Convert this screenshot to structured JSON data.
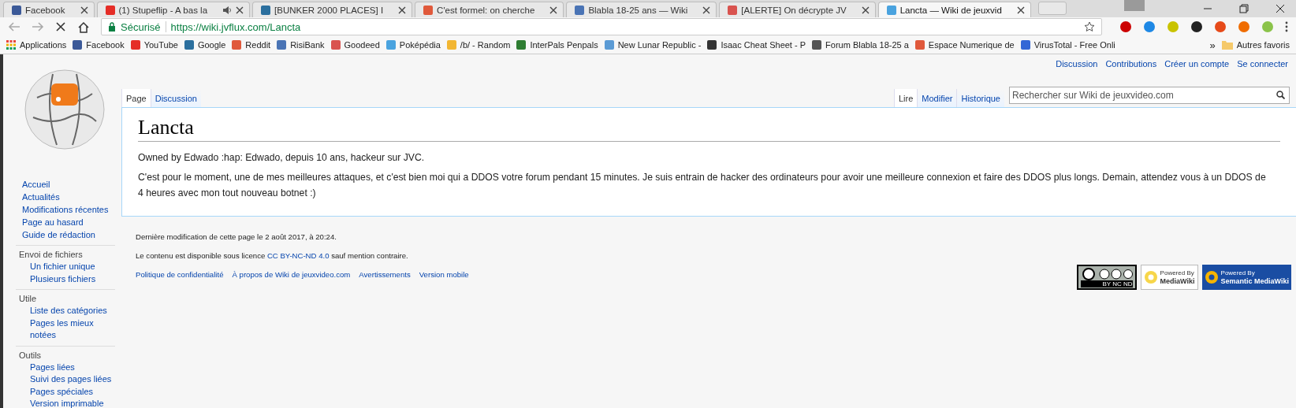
{
  "browser": {
    "tabs": [
      {
        "title": "Facebook",
        "selected": false,
        "audio": false
      },
      {
        "title": "(1) Stupeflip - A bas la",
        "selected": false,
        "audio": true
      },
      {
        "title": "[BUNKER 2000 PLACES] I",
        "selected": false,
        "audio": false
      },
      {
        "title": "C'est formel: on cherche",
        "selected": false,
        "audio": false
      },
      {
        "title": "Blabla 18-25 ans — Wiki",
        "selected": false,
        "audio": false
      },
      {
        "title": "[ALERTE] On décrypte JV",
        "selected": false,
        "audio": false
      },
      {
        "title": "Lancta — Wiki de jeuxvid",
        "selected": true,
        "audio": false
      }
    ],
    "address": {
      "security": "Sécurisé",
      "url": "https://wiki.jvflux.com/Lancta"
    },
    "bookmarks": [
      "Applications",
      "Facebook",
      "YouTube",
      "Google",
      "Reddit",
      "RisiBank",
      "Goodeed",
      "Poképédia",
      "/b/ - Random",
      "InterPals Penpals",
      "New Lunar Republic -",
      "Isaac Cheat Sheet - P",
      "Forum Blabla 18-25 a",
      "Espace Numerique de",
      "VirusTotal - Free Onli"
    ],
    "bookmarks_overflow": "»",
    "other_bookmarks": "Autres favoris"
  },
  "page": {
    "personal": [
      "Discussion",
      "Contributions",
      "Créer un compte",
      "Se connecter"
    ],
    "left_tabs": [
      {
        "label": "Page",
        "selected": true
      },
      {
        "label": "Discussion",
        "selected": false
      }
    ],
    "right_tabs": [
      {
        "label": "Lire",
        "selected": true
      },
      {
        "label": "Modifier",
        "selected": false
      },
      {
        "label": "Historique",
        "selected": false
      }
    ],
    "search": {
      "placeholder": "Rechercher sur Wiki de jeuxvideo.com"
    },
    "title": "Lancta",
    "paragraphs": [
      "Owned by Edwado :hap: Edwado, depuis 10 ans, hackeur sur JVC.",
      "C'est pour le moment, une de mes meilleures attaques, et c'est bien moi qui a DDOS votre forum pendant 15 minutes. Je suis entrain de hacker des ordinateurs pour avoir une meilleure connexion et faire des DDOS plus longs. Demain, attendez vous à un DDOS de 4 heures avec mon tout nouveau botnet :)"
    ],
    "sidebar": [
      {
        "items": [
          "Accueil",
          "Actualités",
          "Modifications récentes",
          "Page au hasard",
          "Guide de rédaction"
        ]
      },
      {
        "heading": "Envoi de fichiers",
        "items": [
          "Un fichier unique",
          "Plusieurs fichiers"
        ]
      },
      {
        "heading": "Utile",
        "items": [
          "Liste des catégories",
          "Pages les mieux notées"
        ]
      },
      {
        "heading": "Outils",
        "items": [
          "Pages liées",
          "Suivi des pages liées",
          "Pages spéciales",
          "Version imprimable"
        ]
      }
    ],
    "footer": {
      "last_modified": "Dernière modification de cette page le 2 août 2017, à 20:24.",
      "license": {
        "before": "Le contenu est disponible sous licence ",
        "link": "CC BY-NC-ND 4.0",
        "after": " sauf mention contraire."
      },
      "links": [
        "Politique de confidentialité",
        "À propos de Wiki de jeuxvideo.com",
        "Avertissements",
        "Version mobile"
      ],
      "badges": [
        {
          "kind": "cc",
          "caption": "BY NC ND"
        },
        {
          "kind": "mediawiki",
          "top": "Powered By",
          "bottom": "MediaWiki"
        },
        {
          "kind": "smw",
          "top": "Powered By",
          "bottom": "Semantic MediaWiki"
        }
      ]
    }
  }
}
